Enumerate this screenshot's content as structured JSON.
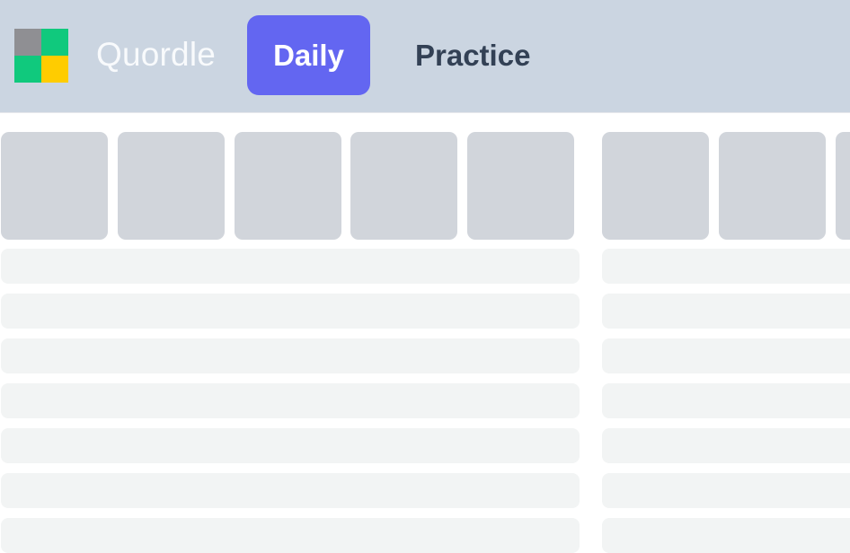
{
  "app": {
    "brand": "Quordle",
    "colors": {
      "header_bg": "#cbd5e1",
      "active_tab_bg": "#6366f1",
      "active_tab_text": "#ffffff",
      "inactive_tab_text": "#334155",
      "brand_text": "#f8fafc",
      "tile_empty": "#d1d5db",
      "row_empty": "#f2f4f4"
    }
  },
  "header": {
    "logo": {
      "icon": "quordle-logo-icon",
      "quadrants": [
        {
          "name": "top-left",
          "color": "#8f8f93"
        },
        {
          "name": "top-right",
          "color": "#10c97d"
        },
        {
          "name": "bottom-left",
          "color": "#10c97d"
        },
        {
          "name": "bottom-right",
          "color": "#ffcc00"
        }
      ]
    },
    "tabs": [
      {
        "label": "Daily",
        "active": true
      },
      {
        "label": "Practice",
        "active": false
      }
    ]
  },
  "boards": {
    "left": {
      "current_row_tiles": [
        "",
        "",
        "",
        "",
        ""
      ],
      "empty_rows": 7
    },
    "right": {
      "current_row_tiles": [
        "",
        "",
        ""
      ],
      "empty_rows": 7
    }
  }
}
